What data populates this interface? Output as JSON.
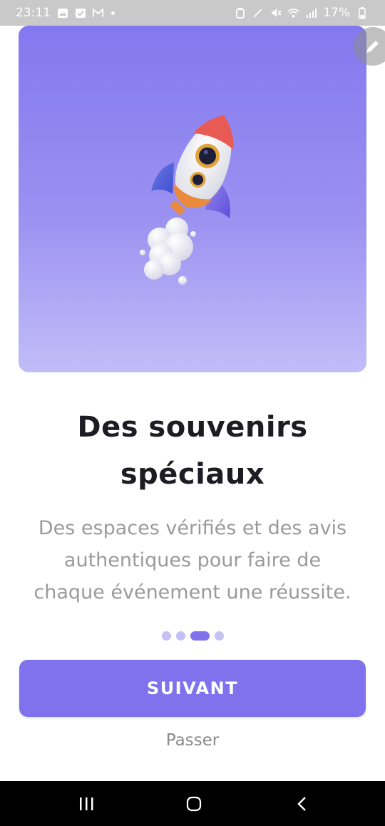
{
  "status_bar": {
    "time": "23:11",
    "battery": "17%",
    "left_icons": [
      "image-icon",
      "checkbox-icon",
      "gmail-icon",
      "dot-icon"
    ],
    "right_icons": [
      "alarm-icon",
      "pen-icon",
      "mute-icon",
      "wifi-icon",
      "signal-icon",
      "battery-icon"
    ]
  },
  "hero": {
    "illustration": "rocket-illustration",
    "gradient": [
      "#8378ef",
      "#c2bdf8"
    ]
  },
  "edit_button": {
    "icon": "pencil-icon"
  },
  "content": {
    "title_line1": "Des souvenirs",
    "title_line2": "spéciaux",
    "description_line1": "Des espaces vérifiés et des avis",
    "description_line2": "authentiques pour faire de",
    "description_line3": "chaque événement une réussite."
  },
  "pager": {
    "total": 4,
    "current": 3
  },
  "actions": {
    "next_label": "SUIVANT",
    "skip_label": "Passer"
  },
  "colors": {
    "accent": "#7f72ec",
    "accent_light": "#c6c0f5",
    "title": "#1c1c22",
    "body": "#9a9a9a"
  },
  "nav_bar": {
    "icons": [
      "recents-icon",
      "home-icon",
      "back-icon"
    ]
  }
}
